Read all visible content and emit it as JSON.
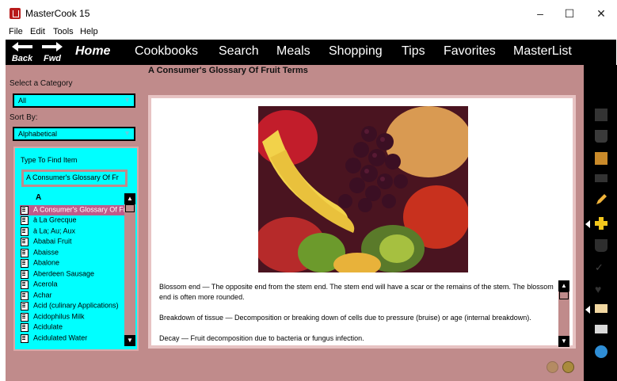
{
  "window": {
    "title": "MasterCook 15",
    "minimize": "–",
    "maximize": "☐",
    "close": "✕"
  },
  "menu": [
    "File",
    "Edit",
    "Tools",
    "Help"
  ],
  "nav": {
    "back_label": "Back",
    "fwd_label": "Fwd",
    "home_label": "Home",
    "links": [
      "Cookbooks",
      "Search",
      "Meals",
      "Shopping",
      "Tips",
      "Favorites",
      "MasterList"
    ]
  },
  "page": {
    "title": "A Consumer's Glossary Of Fruit Terms"
  },
  "filters": {
    "category_label": "Select a Category",
    "category_value": "All",
    "sort_label": "Sort By:",
    "sort_value": "Alphabetical"
  },
  "list": {
    "find_label": "Type To Find Item",
    "find_value": "A Consumer's Glossary Of Fr",
    "letter": "A",
    "items": [
      "A Consumer's Glossary Of Fruit Terms",
      "à La Grecque",
      "à La; Au; Aux",
      "Ababai Fruit",
      "Abaisse",
      "Abalone",
      "Aberdeen Sausage",
      "Acerola",
      "Achar",
      "Acid (culinary Applications)",
      "Acidophilus Milk",
      "Acidulate",
      "Acidulated Water"
    ],
    "selected_index": 0
  },
  "content": {
    "paragraphs": [
      "Blossom end — The opposite end from the stem end. The stem end will have a scar or the remains of the stem. The blossom end is often more rounded.",
      "Breakdown of tissue — Decomposition or breaking down of cells due to pressure (bruise) or age (internal breakdown).",
      "Decay — Fruit decomposition due to bacteria or fungus infection."
    ]
  },
  "sidebar_icons": [
    "recipe-card-icon",
    "flask-icon",
    "box-icon",
    "clipboard-icon",
    "pencil-icon",
    "add-icon",
    "cup-icon",
    "spellcheck-icon",
    "heart-icon",
    "email-icon",
    "printer-icon",
    "globe-icon"
  ],
  "colors": {
    "accent_cyan": "#00ffff",
    "mauve": "#c08b8b",
    "selection": "#c05a8a"
  }
}
